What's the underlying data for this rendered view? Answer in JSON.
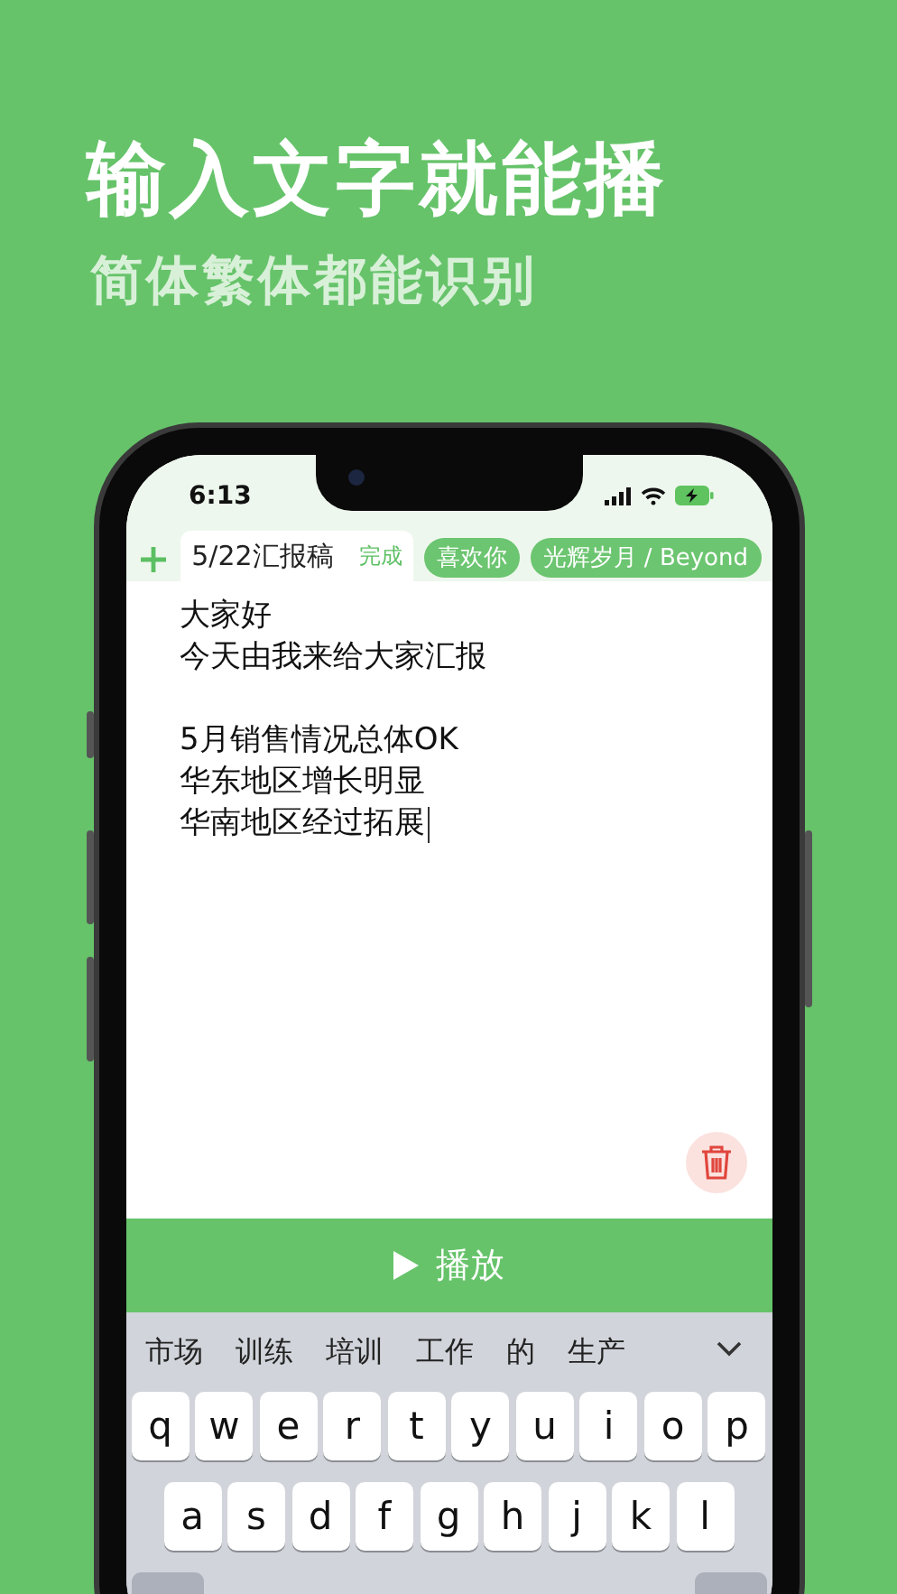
{
  "headline": "输入文字就能播",
  "subheadline": "简体繁体都能识别",
  "status_bar": {
    "time": "6:13"
  },
  "tabs": [
    {
      "label": "5/22汇报稿",
      "action": "完成",
      "selected": true
    },
    {
      "label": "喜欢你",
      "selected": false
    },
    {
      "label": "光辉岁月 / Beyond",
      "selected": false
    }
  ],
  "editor": {
    "paragraphs": [
      {
        "lines": [
          "大家好",
          "今天由我来给大家汇报"
        ]
      },
      {
        "lines": [
          "5月销售情况总体OK",
          "华东地区增长明显",
          "华南地区经过拓展"
        ]
      }
    ]
  },
  "play_button": {
    "label": "播放"
  },
  "keyboard": {
    "candidates": [
      "市场",
      "训练",
      "培训",
      "工作",
      "的",
      "生产"
    ],
    "rows": [
      [
        "q",
        "w",
        "e",
        "r",
        "t",
        "y",
        "u",
        "i",
        "o",
        "p"
      ],
      [
        "a",
        "s",
        "d",
        "f",
        "g",
        "h",
        "j",
        "k",
        "l"
      ]
    ]
  }
}
